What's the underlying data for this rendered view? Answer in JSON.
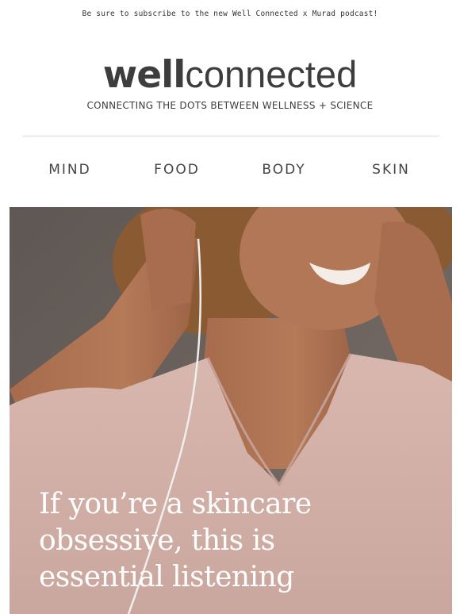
{
  "preheader": "Be sure to subscribe to the new Well Connected x Murad podcast!",
  "brand": {
    "bold": "well",
    "light": "connected"
  },
  "tagline": "CONNECTING THE DOTS BETWEEN WELLNESS + SCIENCE",
  "nav": [
    {
      "label": "MIND"
    },
    {
      "label": "FOOD"
    },
    {
      "label": "BODY"
    },
    {
      "label": "SKIN"
    }
  ],
  "hero": {
    "headline_lines": [
      "If you’re a skincare",
      "obsessive, this is",
      "essential listening"
    ]
  },
  "colors": {
    "brand_text": "#3d3d3d",
    "hero_background": "#6a615c",
    "shirt": "#d9b8b0",
    "headline": "#ffffff"
  }
}
